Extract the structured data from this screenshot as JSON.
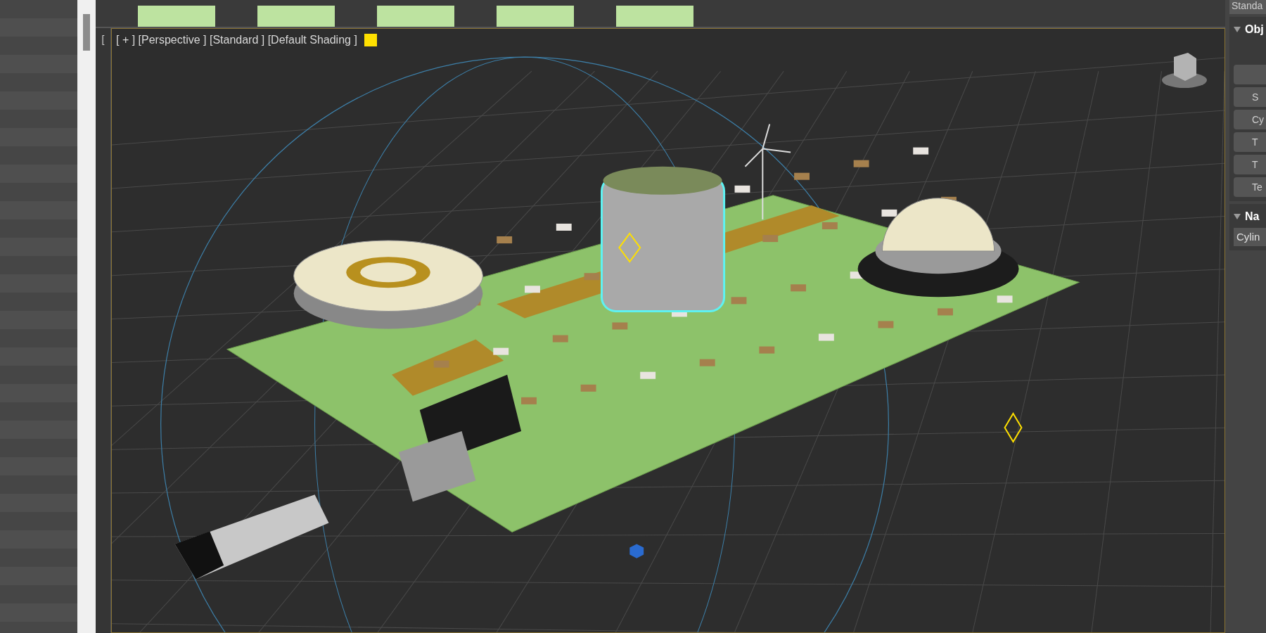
{
  "viewport": {
    "corner_bracket": "[",
    "label": "[ + ] [Perspective ] [Standard ] [Default Shading ]"
  },
  "command_panel": {
    "dropdown": "Standa",
    "rollouts": [
      {
        "kind": "buttons",
        "title": "Obj",
        "expanded": true,
        "buttons": [
          "S",
          "Cy",
          "T",
          "T",
          "Te"
        ]
      },
      {
        "kind": "field",
        "title": "Na",
        "expanded": true,
        "value": "Cylin"
      }
    ]
  }
}
